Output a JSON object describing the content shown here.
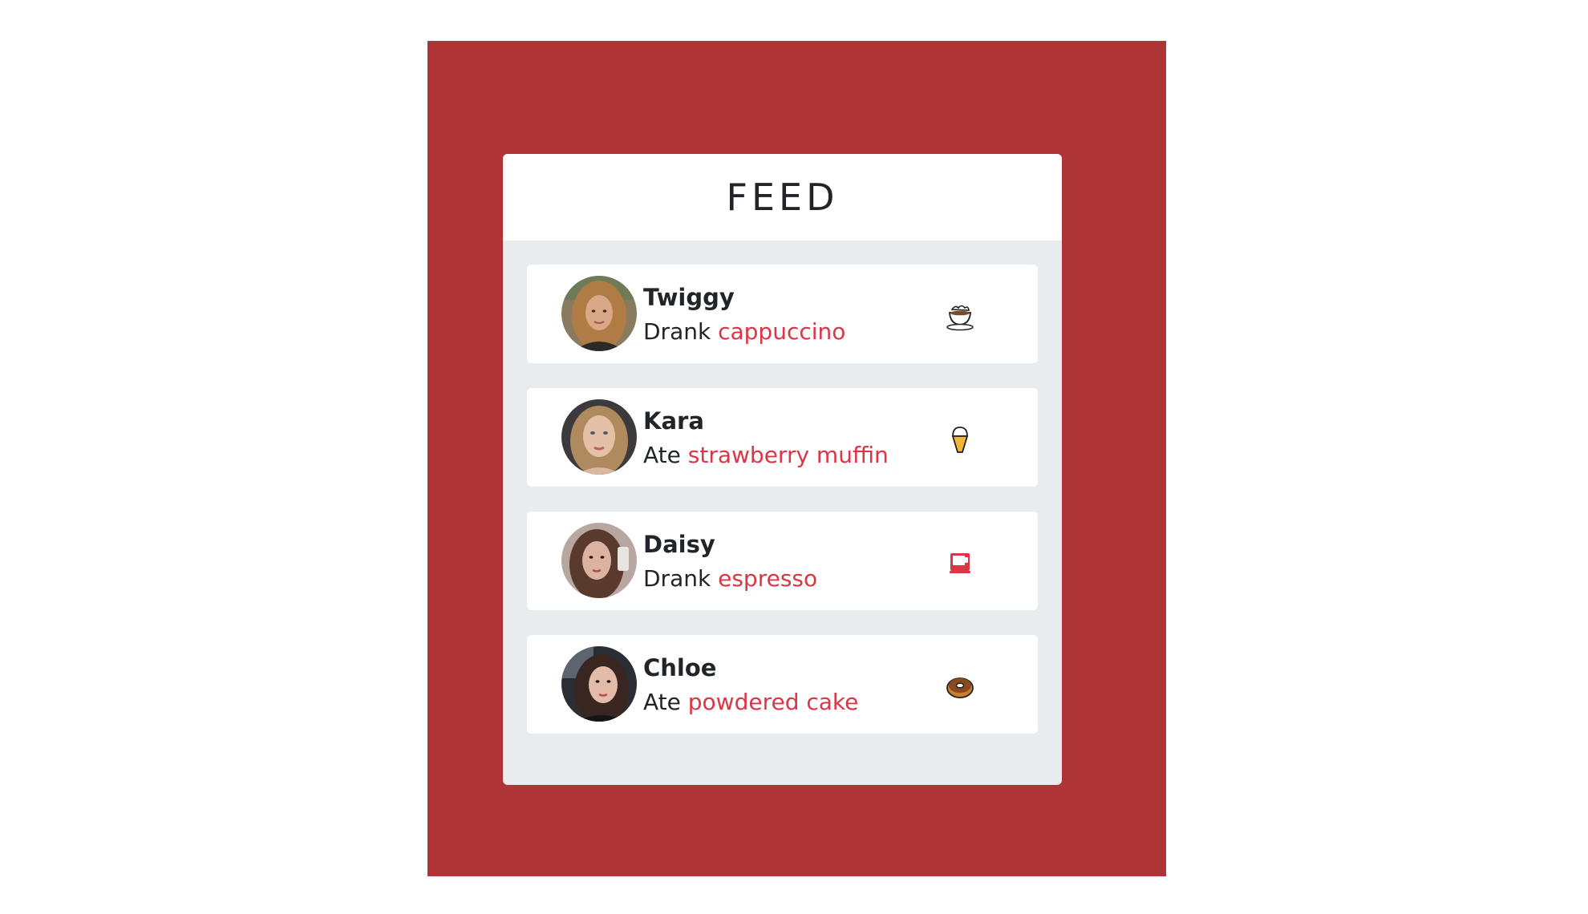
{
  "feed": {
    "title": "FEED",
    "items": [
      {
        "name": "Twiggy",
        "verb": "Drank",
        "item": "cappuccino",
        "icon": "coffee-cup-icon",
        "avatar": "avatar-twiggy"
      },
      {
        "name": "Kara",
        "verb": "Ate",
        "item": "strawberry muffin",
        "icon": "ice-cream-icon",
        "avatar": "avatar-kara"
      },
      {
        "name": "Daisy",
        "verb": "Drank",
        "item": "espresso",
        "icon": "mug-icon",
        "avatar": "avatar-daisy"
      },
      {
        "name": "Chloe",
        "verb": "Ate",
        "item": "powdered cake",
        "icon": "donut-icon",
        "avatar": "avatar-chloe"
      }
    ]
  },
  "colors": {
    "frame_background": "#ae3436",
    "card_background": "#e9ecef",
    "accent_text": "#dc3545",
    "primary_text": "#212529"
  }
}
